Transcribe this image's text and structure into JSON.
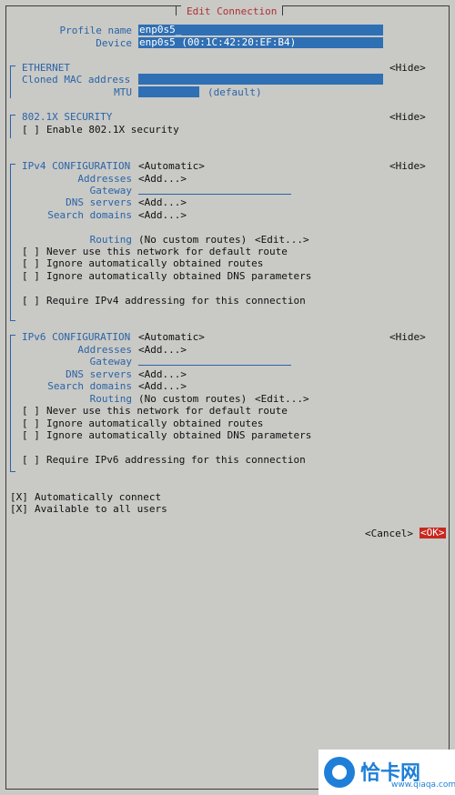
{
  "dialog": {
    "title": "Edit Connection"
  },
  "profile": {
    "name_label": "Profile name",
    "name_value": "enp0s5_",
    "device_label": "Device",
    "device_value": "enp0s5 (00:1C:42:20:EF:B4)"
  },
  "ethernet": {
    "heading": "ETHERNET",
    "toggle": "<Hide>",
    "cloned_mac_label": "Cloned MAC address",
    "cloned_mac_value": "",
    "mtu_label": "MTU",
    "mtu_value": "",
    "mtu_hint": "(default)"
  },
  "security": {
    "heading": "802.1X SECURITY",
    "toggle": "<Hide>",
    "enable_checkbox": "[ ]",
    "enable_label": "Enable 802.1X security"
  },
  "ipv4": {
    "heading": "IPv4 CONFIGURATION",
    "mode": "<Automatic>",
    "toggle": "<Hide>",
    "addresses_label": "Addresses",
    "addresses_add": "<Add...>",
    "gateway_label": "Gateway",
    "dns_label": "DNS servers",
    "dns_add": "<Add...>",
    "search_label": "Search domains",
    "search_add": "<Add...>",
    "routing_label": "Routing",
    "routing_value": "(No custom routes)",
    "routing_edit": "<Edit...>",
    "options": [
      {
        "box": "[ ]",
        "label": "Never use this network for default route"
      },
      {
        "box": "[ ]",
        "label": "Ignore automatically obtained routes"
      },
      {
        "box": "[ ]",
        "label": "Ignore automatically obtained DNS parameters"
      }
    ],
    "require": {
      "box": "[ ]",
      "label": "Require IPv4 addressing for this connection"
    }
  },
  "ipv6": {
    "heading": "IPv6 CONFIGURATION",
    "mode": "<Automatic>",
    "toggle": "<Hide>",
    "addresses_label": "Addresses",
    "addresses_add": "<Add...>",
    "gateway_label": "Gateway",
    "dns_label": "DNS servers",
    "dns_add": "<Add...>",
    "search_label": "Search domains",
    "search_add": "<Add...>",
    "routing_label": "Routing",
    "routing_value": "(No custom routes)",
    "routing_edit": "<Edit...>",
    "options": [
      {
        "box": "[ ]",
        "label": "Never use this network for default route"
      },
      {
        "box": "[ ]",
        "label": "Ignore automatically obtained routes"
      },
      {
        "box": "[ ]",
        "label": "Ignore automatically obtained DNS parameters"
      }
    ],
    "require": {
      "box": "[ ]",
      "label": "Require IPv6 addressing for this connection"
    }
  },
  "general": {
    "auto_connect": {
      "box": "[X]",
      "label": "Automatically connect"
    },
    "all_users": {
      "box": "[X]",
      "label": "Available to all users"
    }
  },
  "buttons": {
    "cancel": "<Cancel>",
    "ok": "<OK>"
  },
  "watermark": {
    "brand": "恰卡网",
    "url": "www.qiaqa.com"
  }
}
